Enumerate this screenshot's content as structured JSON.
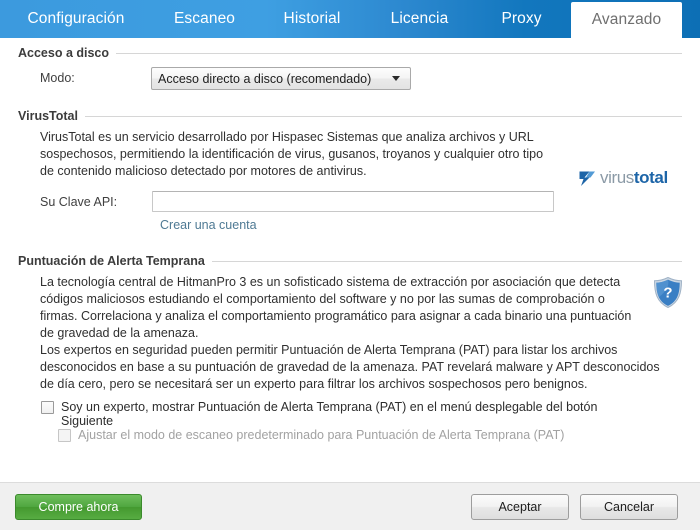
{
  "tabs": [
    {
      "label": "Configuración",
      "active": false
    },
    {
      "label": "Escaneo",
      "active": false
    },
    {
      "label": "Historial",
      "active": false
    },
    {
      "label": "Licencia",
      "active": false
    },
    {
      "label": "Proxy",
      "active": false
    },
    {
      "label": "Avanzado",
      "active": true
    }
  ],
  "disk_access": {
    "group_title": "Acceso a disco",
    "mode_label": "Modo:",
    "mode_value": "Acceso directo a disco (recomendado)"
  },
  "virustotal": {
    "group_title": "VirusTotal",
    "description": "VirusTotal es un servicio desarrollado por Hispasec Sistemas que analiza archivos y URL sospechosos, permitiendo la identificación de virus, gusanos, troyanos y cualquier otro tipo de contenido malicioso detectado por motores de antivirus.",
    "api_key_label": "Su Clave API:",
    "api_key_value": "",
    "api_key_placeholder": "",
    "create_account_link": "Crear una cuenta",
    "logo_part_gray": "virus",
    "logo_part_blue": "total",
    "logo_icon": "virustotal-icon"
  },
  "pat": {
    "group_title": "Puntuación de Alerta Temprana",
    "paragraph_1": "La tecnología central de HitmanPro 3 es un sofisticado sistema de extracción por asociación que detecta códigos maliciosos estudiando el comportamiento del software y no por las sumas de comprobación o firmas. Correlaciona y analiza el comportamiento programático para asignar a cada binario una puntuación de gravedad de la amenaza.",
    "paragraph_2": "Los expertos en seguridad pueden permitir Puntuación de Alerta Temprana (PAT) para listar los archivos desconocidos en base a su puntuación de gravedad de la amenaza. PAT revelará malware y APT desconocidos de día cero, pero se necesitará ser un experto para filtrar los archivos sospechosos pero benignos.",
    "help_icon": "shield-question-icon",
    "checkbox_expert": {
      "label": "Soy un experto, mostrar Puntuación de Alerta Temprana (PAT) en el menú desplegable del botón Siguiente",
      "checked": false,
      "disabled": false
    },
    "checkbox_adjust": {
      "label": "Ajustar el modo de escaneo predeterminado para Puntuación de Alerta Temprana (PAT)",
      "checked": false,
      "disabled": true
    }
  },
  "footer": {
    "buy_label": "Compre ahora",
    "accept_label": "Aceptar",
    "cancel_label": "Cancelar"
  },
  "colors": {
    "tab_bar_left": "#3c9ade",
    "tab_bar_right": "#0d6fb5",
    "active_tab_bg": "#ffffff",
    "buy_button_green": "#4fa63f",
    "link_blue": "#4f7a94",
    "vt_blue": "#1d65a8",
    "shield_blue": "#2f73b8"
  }
}
